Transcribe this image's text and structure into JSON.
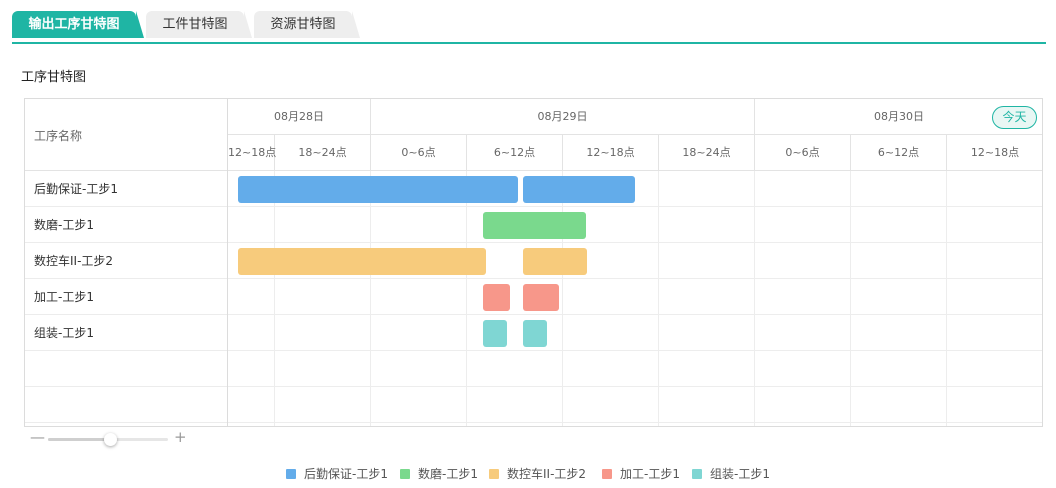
{
  "tabs": [
    {
      "label": "输出工序甘特图",
      "active": true
    },
    {
      "label": "工件甘特图",
      "active": false
    },
    {
      "label": "资源甘特图",
      "active": false
    }
  ],
  "section_title": "工序甘特图",
  "gantt": {
    "task_column_header": "工序名称",
    "today_label": "今天",
    "days": [
      "08月28日",
      "08月29日",
      "08月30日"
    ],
    "slots": [
      "12~18点",
      "18~24点",
      "0~6点",
      "6~12点",
      "12~18点",
      "18~24点",
      "0~6点",
      "6~12点",
      "12~18点"
    ],
    "tasks": [
      "后勤保证-工步1",
      "数磨-工步1",
      "数控车II-工步2",
      "加工-工步1",
      "组装-工步1"
    ],
    "bars": [
      {
        "task": 0,
        "color": "#63acea"
      },
      {
        "task": 0,
        "color": "#63acea"
      },
      {
        "task": 1,
        "color": "#7ad98d"
      },
      {
        "task": 2,
        "color": "#f7cb7c"
      },
      {
        "task": 2,
        "color": "#f7cb7c"
      },
      {
        "task": 3,
        "color": "#f7978a"
      },
      {
        "task": 3,
        "color": "#f7978a"
      },
      {
        "task": 4,
        "color": "#7fd6d3"
      },
      {
        "task": 4,
        "color": "#7fd6d3"
      }
    ]
  },
  "zoom": {
    "minus_icon": "minus-icon",
    "plus_icon": "plus-icon",
    "level": 0.5
  },
  "legend": [
    {
      "label": "后勤保证-工步1",
      "color": "#63acea"
    },
    {
      "label": "数磨-工步1",
      "color": "#7ad98d"
    },
    {
      "label": "数控车II-工步2",
      "color": "#f7cb7c"
    },
    {
      "label": "加工-工步1",
      "color": "#f7978a"
    },
    {
      "label": "组装-工步1",
      "color": "#7fd6d3"
    }
  ],
  "colors": {
    "accent": "#1fb5a4"
  }
}
